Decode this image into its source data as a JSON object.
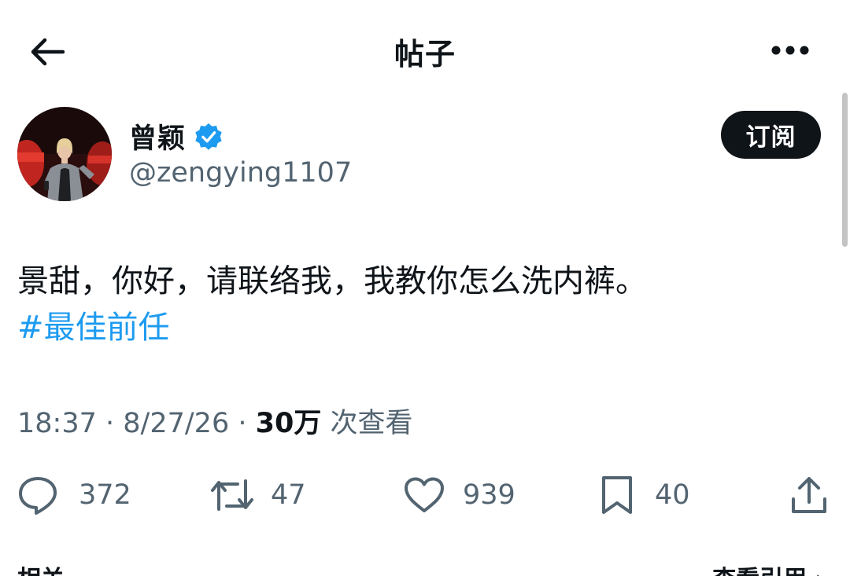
{
  "header": {
    "title": "帖子",
    "back_icon": "arrow-left-icon",
    "more_icon": "more-horizontal-icon"
  },
  "author": {
    "display_name": "曾颖",
    "handle": "@zengying1107",
    "verified": true,
    "verified_color": "#1d9bf0"
  },
  "subscribe_label": "订阅",
  "post": {
    "text": "景甜，你好，请联络我，我教你怎么洗内裤。",
    "hashtag": "#最佳前任"
  },
  "meta": {
    "time": "18:37",
    "date": "8/27/26",
    "views_count": "30万",
    "views_label": "次查看"
  },
  "actions": {
    "replies": "372",
    "reposts": "47",
    "likes": "939",
    "bookmarks": "40"
  },
  "bottom": {
    "left_label": "相关",
    "right_label": "查看引用 ›"
  },
  "colors": {
    "accent": "#1d9bf0",
    "text": "#0f1419",
    "muted": "#536471"
  }
}
